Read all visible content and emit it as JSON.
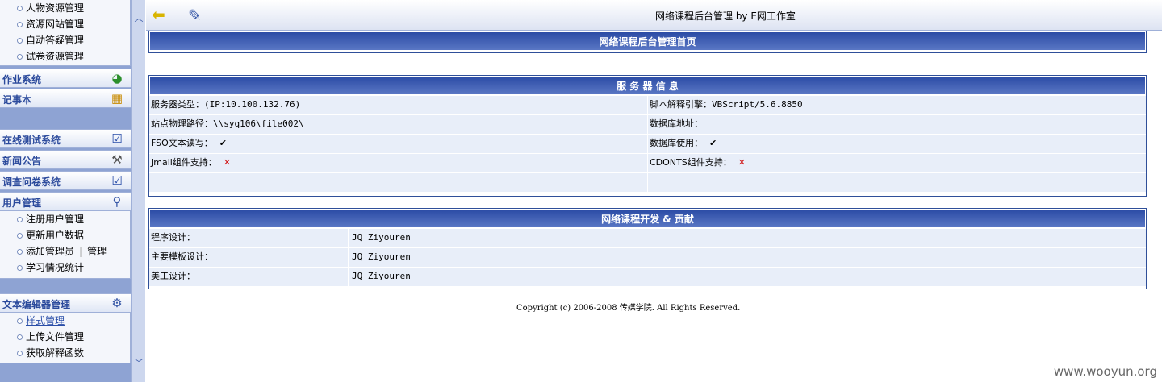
{
  "window": {
    "title": "网络课程后台管理   by  E网工作室"
  },
  "sidebar": {
    "group_top": [
      "人物资源管理",
      "资源网站管理",
      "自动答疑管理",
      "试卷资源管理"
    ],
    "heads": [
      {
        "label": "作业系统",
        "icon": "clock-icon"
      },
      {
        "label": "记事本",
        "icon": "calendar-icon"
      },
      {
        "label": "在线测试系统",
        "icon": "checklist-icon"
      },
      {
        "label": "新闻公告",
        "icon": "tools-icon"
      },
      {
        "label": "调查问卷系统",
        "icon": "checklist-icon"
      },
      {
        "label": "用户管理",
        "icon": "user-search-icon"
      },
      {
        "label": "文本编辑器管理",
        "icon": "gear-icon"
      }
    ],
    "user_items": [
      "注册用户管理",
      "更新用户数据",
      "添加管理员",
      "学习情况统计"
    ],
    "admin_sep": "|",
    "admin_extra": "管理",
    "editor_items": [
      "样式管理",
      "上传文件管理",
      "获取解释函数"
    ]
  },
  "main": {
    "home_title": "网络课程后台管理首页",
    "server": {
      "title": "服 务 器 信 息",
      "rows": [
        {
          "l_label": "服务器类型：",
          "l_value": "(IP:10.100.132.76)",
          "r_label": "脚本解释引擎：",
          "r_value": "VBScript/5.6.8850"
        },
        {
          "l_label": "站点物理路径：",
          "l_value": "\\\\syq106\\file002\\",
          "r_label": "数据库地址：",
          "r_value": ""
        },
        {
          "l_label": "FSO文本读写：",
          "l_value": "✔",
          "r_label": "数据库使用：",
          "r_value": "✔"
        },
        {
          "l_label": "Jmail组件支持：",
          "l_value": "✕",
          "r_label": "CDONTS组件支持：",
          "r_value": "✕"
        }
      ]
    },
    "credits": {
      "title": "网络课程开发 & 贡献",
      "rows": [
        {
          "label": "程序设计：",
          "value": "JQ  Ziyouren"
        },
        {
          "label": "主要模板设计：",
          "value": "JQ  Ziyouren"
        },
        {
          "label": "美工设计：",
          "value": "JQ  Ziyouren"
        }
      ]
    },
    "copyright": "Copyright (c) 2006-2008 传媒学院. All Rights Reserved."
  },
  "watermark": "www.wooyun.org"
}
